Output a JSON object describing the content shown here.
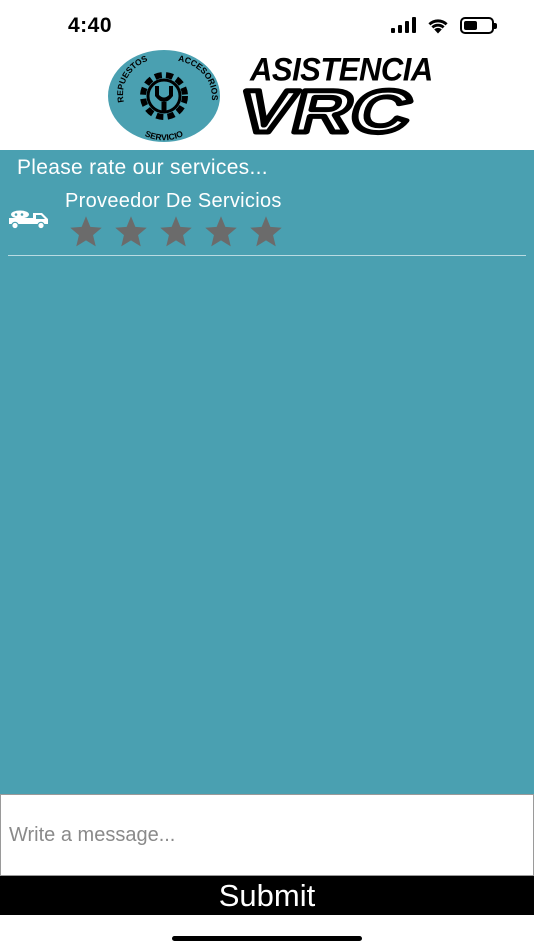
{
  "status_bar": {
    "time": "4:40",
    "icons": [
      "cellular-signal-icon",
      "wifi-icon",
      "battery-icon"
    ],
    "battery_level": 0.5
  },
  "header": {
    "badge": {
      "text_top": "REPUESTOS",
      "text_right": "ACCESORIOS",
      "text_bottom": "SERVICIO",
      "color": "#4aa0b1",
      "icon": "gear-wrench-icon"
    },
    "wordmark": {
      "top": "ASISTENCIA",
      "bottom": "VRC"
    }
  },
  "main": {
    "background": "#4aa0b1",
    "prompt": "Please rate our services...",
    "provider": {
      "icon": "tow-truck-icon",
      "name": "Proveedor De Servicios",
      "rating": 0,
      "max_rating": 5,
      "star_color": "#6b6b6b"
    }
  },
  "message": {
    "value": "",
    "placeholder": "Write a message..."
  },
  "submit": {
    "label": "Submit"
  }
}
